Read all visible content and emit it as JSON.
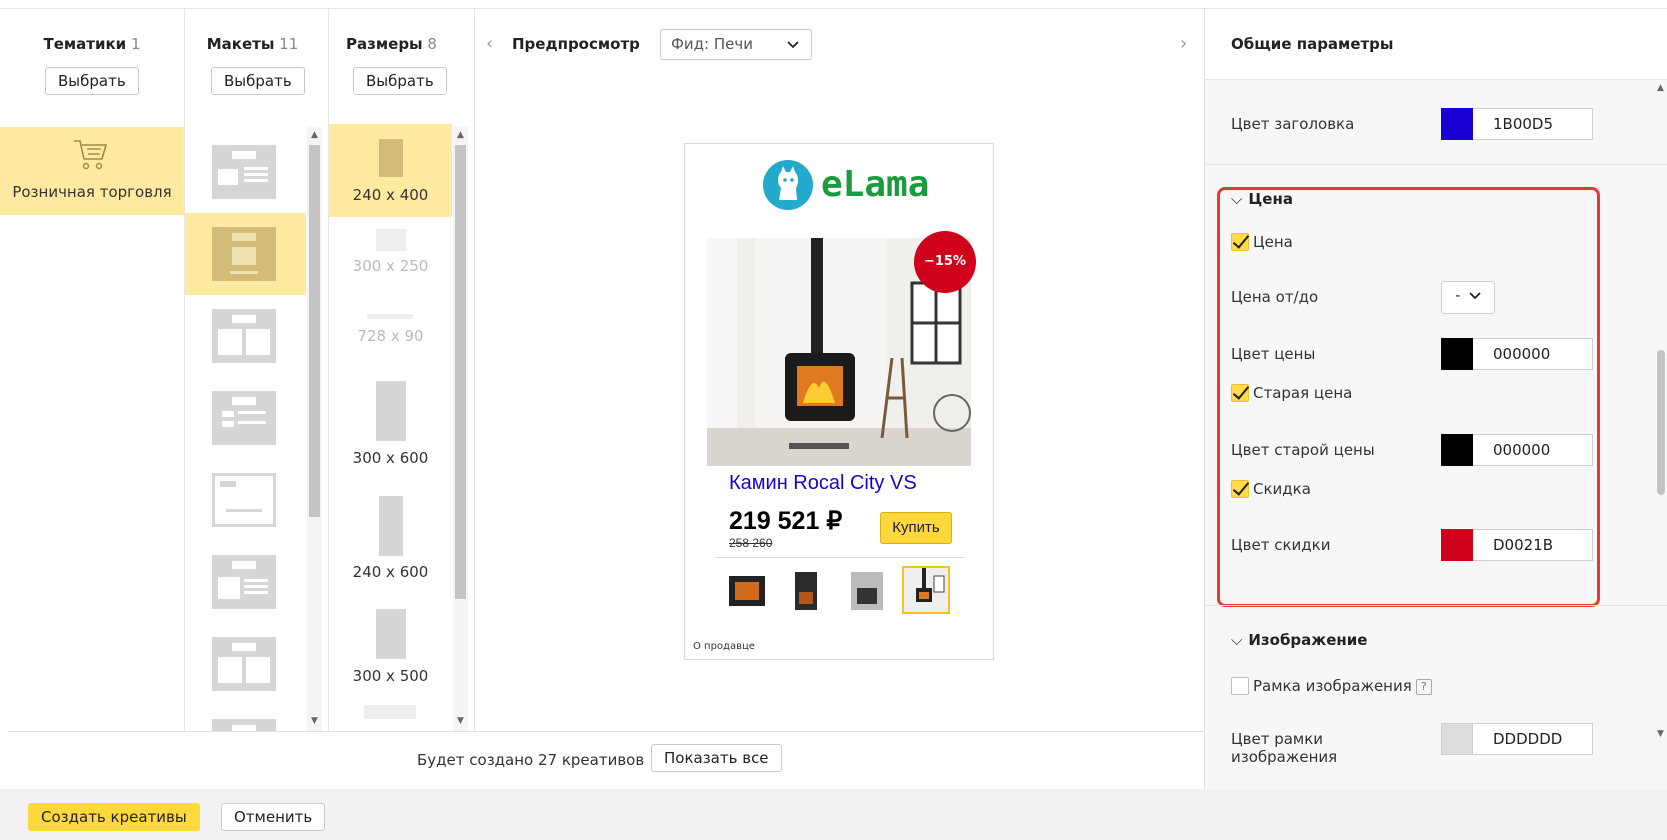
{
  "columns": {
    "themes": {
      "title": "Тематики",
      "count": "1",
      "button": "Выбрать",
      "item_label": "Розничная торговля"
    },
    "layouts": {
      "title": "Макеты",
      "count": "11",
      "button": "Выбрать"
    },
    "sizes": {
      "title": "Размеры",
      "count": "8",
      "button": "Выбрать",
      "items": [
        "240 x 400",
        "300 x 250",
        "728 x 90",
        "300 x 600",
        "240 x 600",
        "300 x 500"
      ]
    }
  },
  "preview": {
    "title": "Предпросмотр",
    "feed_select": "Фид: Печи",
    "ad": {
      "logo_text": "eLama",
      "discount_badge": "−15%",
      "product_title": "Камин Rocal City VS",
      "price": "219 521 ₽",
      "old_price": "258 260",
      "buy_label": "Купить",
      "seller_link": "О продавце"
    }
  },
  "bottom": {
    "created_text": "Будет создано 27 креативов",
    "show_all": "Показать все"
  },
  "footer": {
    "create_label": "Создать креативы",
    "cancel_label": "Отменить"
  },
  "panel": {
    "title": "Общие параметры",
    "header_color_label": "Цвет заголовка",
    "header_color": "1B00D5",
    "price_section": {
      "title": "Цена",
      "price_checkbox": "Цена",
      "price_from_to_label": "Цена от/до",
      "price_from_to_value": "-",
      "price_color_label": "Цвет цены",
      "price_color": "000000",
      "old_price_checkbox": "Старая цена",
      "old_price_color_label": "Цвет старой цены",
      "old_price_color": "000000",
      "discount_checkbox": "Скидка",
      "discount_color_label": "Цвет скидки",
      "discount_color": "D0021B"
    },
    "image_section": {
      "title": "Изображение",
      "frame_checkbox": "Рамка изображения",
      "help": "?",
      "frame_color_label_1": "Цвет рамки",
      "frame_color_label_2": "изображения",
      "frame_color": "DDDDDD"
    }
  },
  "colors": {
    "accent": "#ffd83b",
    "selection": "#ffeaa0",
    "title_blue": "#1b00d5",
    "discount_red": "#d0021b",
    "highlight_red": "#e53935"
  }
}
